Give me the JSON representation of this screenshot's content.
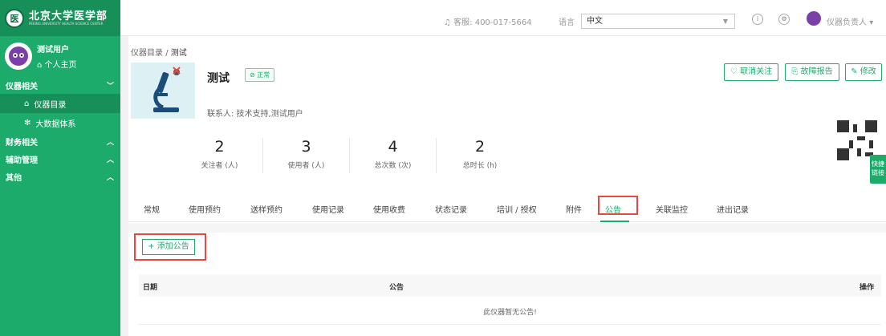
{
  "sidebar": {
    "logo_text": "北京大学医学部",
    "logo_sub": "PEKING UNIVERSITY HEALTH SCIENCE CENTER",
    "user_name": "测试用户",
    "user_home": "个人主页",
    "groups": [
      {
        "label": "仪器相关"
      },
      {
        "label": "财务相关"
      },
      {
        "label": "辅助管理"
      },
      {
        "label": "其他"
      }
    ],
    "items": [
      {
        "label": "仪器目录",
        "icon": "home-outline-icon"
      },
      {
        "label": "大数据体系",
        "icon": "gear-icon"
      }
    ]
  },
  "topbar": {
    "hotline": "客服: 400-017-5664",
    "lang_label": "语言",
    "lang_value": "中文",
    "user_label": "仪器负责人"
  },
  "breadcrumb": {
    "root": "仪器目录",
    "separator": "/",
    "current": "测试"
  },
  "instrument": {
    "title": "测试",
    "status": "正常",
    "contact": "联系人: 技术支持,测试用户"
  },
  "actions": {
    "unfollow": "取消关注",
    "fault_report": "故障报告",
    "edit": "修改"
  },
  "quick_link": "快捷链接",
  "stats": [
    {
      "value": "2",
      "label": "关注者 (人)"
    },
    {
      "value": "3",
      "label": "使用者 (人)"
    },
    {
      "value": "4",
      "label": "总次数 (次)"
    },
    {
      "value": "2",
      "label": "总时长 (h)"
    }
  ],
  "tabs": [
    "常规",
    "使用预约",
    "送样预约",
    "使用记录",
    "使用收费",
    "状态记录",
    "培训 / 授权",
    "附件",
    "公告",
    "关联监控",
    "进出记录"
  ],
  "active_tab": "公告",
  "notice": {
    "add_button": "+ 添加公告",
    "col_date": "日期",
    "col_notice": "公告",
    "col_action": "操作",
    "empty": "此仪器暂无公告!"
  },
  "colors": {
    "accent": "#1dab6c",
    "highlight": "#e8483f"
  }
}
